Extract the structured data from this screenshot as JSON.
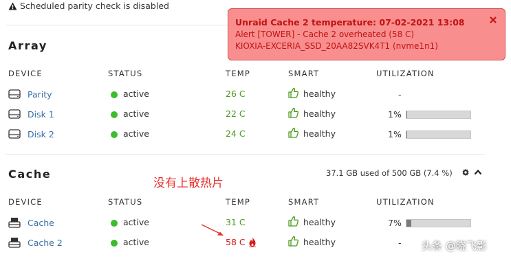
{
  "notice": {
    "text": "Scheduled parity check is disabled",
    "icon": "warning-icon"
  },
  "array": {
    "title": "Array",
    "columns": [
      "DEVICE",
      "STATUS",
      "TEMP",
      "SMART",
      "UTILIZATION"
    ],
    "rows": [
      {
        "device": "Parity",
        "status": "active",
        "temp": "26 C",
        "smart": "healthy",
        "util_text": "-",
        "util_fraction": null
      },
      {
        "device": "Disk 1",
        "status": "active",
        "temp": "22 C",
        "smart": "healthy",
        "util_text": "1%",
        "util_fraction": 0.01
      },
      {
        "device": "Disk 2",
        "status": "active",
        "temp": "24 C",
        "smart": "healthy",
        "util_text": "1%",
        "util_fraction": 0.01
      }
    ]
  },
  "cache": {
    "title": "Cache",
    "usage": "37.1 GB used of 500 GB (7.4 %)",
    "columns": [
      "DEVICE",
      "STATUS",
      "TEMP",
      "SMART",
      "UTILIZATION"
    ],
    "rows": [
      {
        "device": "Cache",
        "status": "active",
        "temp": "31 C",
        "smart": "healthy",
        "util_text": "7%",
        "util_fraction": 0.07
      },
      {
        "device": "Cache 2",
        "status": "active",
        "temp": "58 C",
        "smart": "healthy",
        "util_text": "-",
        "util_fraction": null,
        "hot": true
      }
    ]
  },
  "annotation": "没有上散热片",
  "alert": {
    "title": "Unraid Cache 2 temperature: 07-02-2021 13:08",
    "line1": "Alert [TOWER] - Cache 2 overheated (58 C)",
    "line2": "KIOXIA-EXCERIA_SSD_20AA82SVK4T1 (nvme1n1)"
  },
  "watermark": "头条 @晓飞影",
  "colors": {
    "link": "#3b6ea5",
    "active": "#3cbc2e",
    "temp_ok": "#4a9a1e",
    "temp_hot": "#d21a1a",
    "alert_bg": "#f98e8e",
    "alert_text": "#c11212",
    "annotation": "#e8312c"
  }
}
